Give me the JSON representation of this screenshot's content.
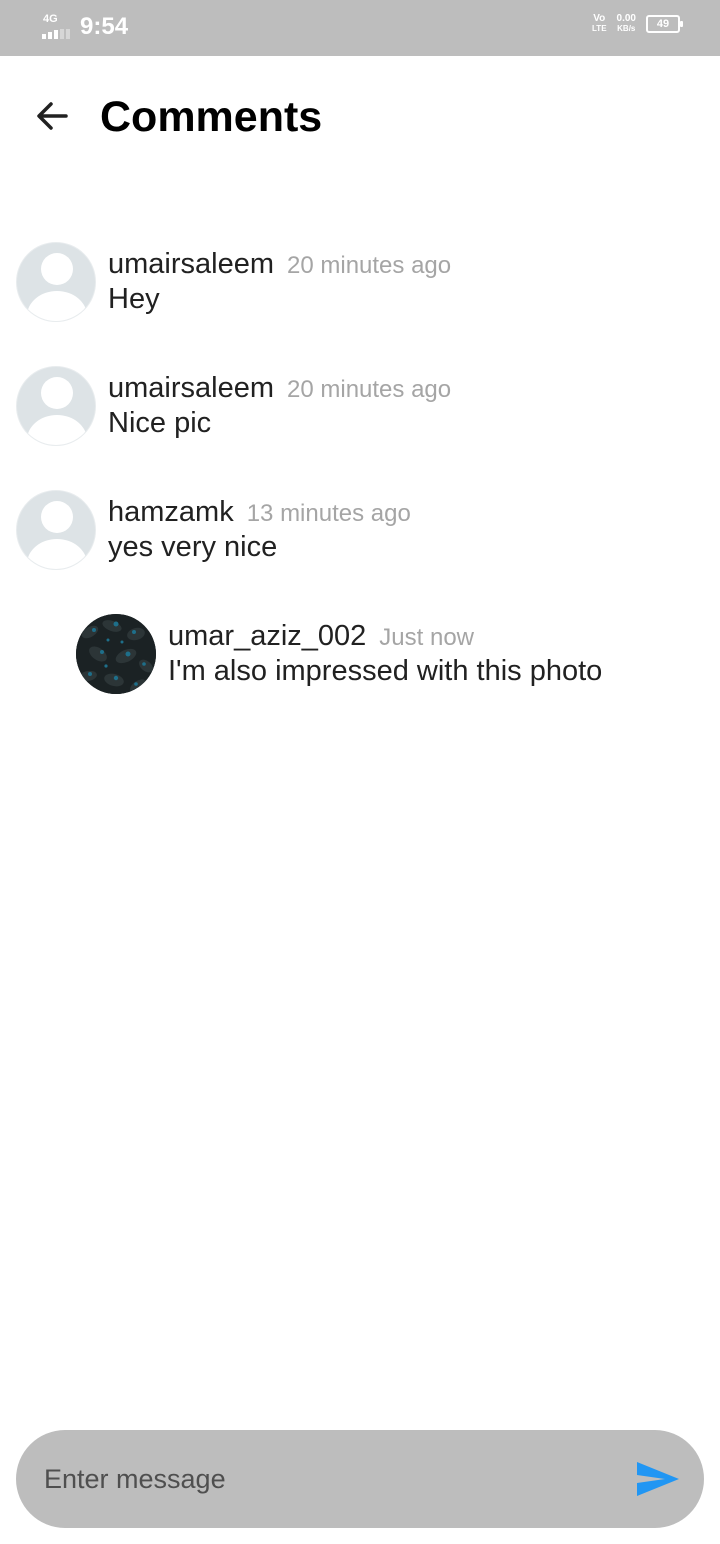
{
  "status_bar": {
    "network": "4G",
    "time": "9:54",
    "volte_top": "Vo",
    "volte_bottom": "LTE",
    "speed_value": "0.00",
    "speed_unit": "KB/s",
    "battery": "49"
  },
  "header": {
    "back_icon": "arrow-left-icon",
    "title": "Comments"
  },
  "comments": [
    {
      "username": "umairsaleem",
      "time": "20 minutes ago",
      "text": "Hey",
      "avatar": "default-avatar",
      "reply": false
    },
    {
      "username": "umairsaleem",
      "time": "20 minutes ago",
      "text": "Nice pic",
      "avatar": "default-avatar",
      "reply": false
    },
    {
      "username": "hamzamk",
      "time": "13 minutes ago",
      "text": "yes very nice",
      "avatar": "default-avatar",
      "reply": false
    },
    {
      "username": "umar_aziz_002",
      "time": "Just now",
      "text": "I'm also impressed with this photo",
      "avatar": "profile-photo",
      "reply": true
    }
  ],
  "composer": {
    "placeholder": "Enter message",
    "value": "",
    "send_icon": "send-icon"
  },
  "colors": {
    "status_bar": "#bdbdbd",
    "background": "#ffffff",
    "title": "#000000",
    "username": "#212121",
    "timestamp": "#a5a5a5",
    "composer": "#bdbdbd",
    "send": "#2196f3",
    "avatar_placeholder": "#dde3e6"
  }
}
